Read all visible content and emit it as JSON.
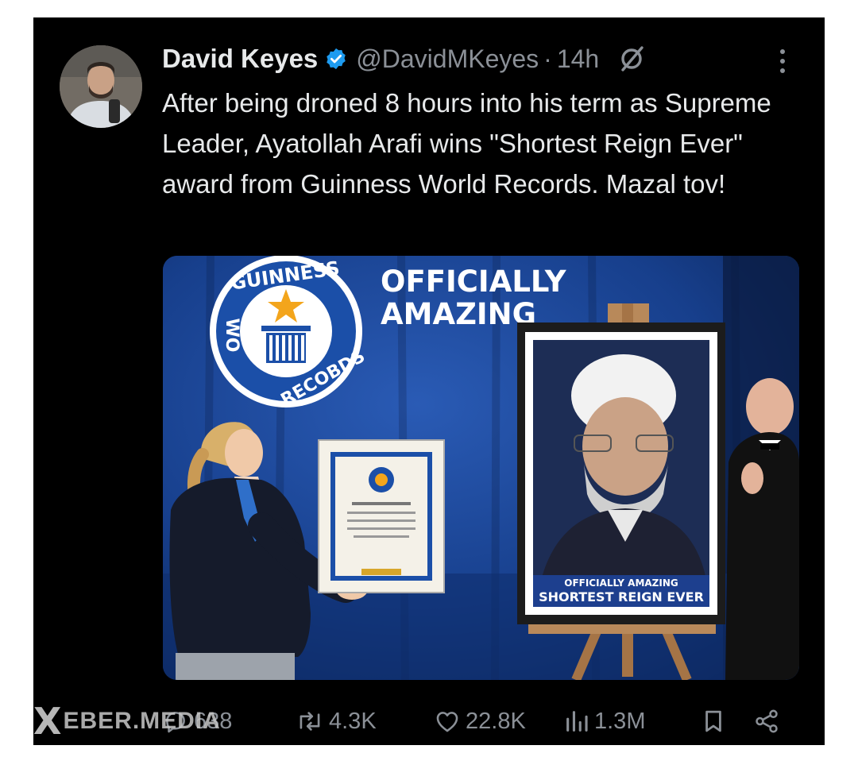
{
  "tweet": {
    "display_name": "David Keyes",
    "handle": "@DavidMKeyes",
    "separator": "·",
    "time": "14h",
    "text": "After being droned 8 hours into his term as Supreme Leader, Ayatollah Arafi wins \"Shortest Reign Ever\" award from Guinness World Records. Mazal tov!",
    "icons": [
      "verified-badge-icon",
      "grok-icon",
      "more-options-icon"
    ],
    "verified_color": "#1d9bf0"
  },
  "media": {
    "logo_top_text": "GUINNESS",
    "logo_left_text": "WO",
    "logo_bottom_text": "RECOBDS",
    "banner_line1": "OFFICIALLY",
    "banner_line2": "AMAZING",
    "portrait_caption_line1": "OFFICIALLY AMAZING",
    "portrait_caption_line2": "SHORTEST REIGN EVER"
  },
  "actions": {
    "replies": "638",
    "reposts": "4.3K",
    "likes": "22.8K",
    "views": "1.3M",
    "icons": [
      "reply-icon",
      "repost-icon",
      "like-icon",
      "views-icon",
      "bookmark-icon",
      "share-icon"
    ]
  },
  "watermark": {
    "x_mark": "X",
    "text": "EBER.MEDIA"
  },
  "colors": {
    "background": "#000000",
    "text": "#e7e9ea",
    "muted": "#8b9097",
    "stage_blue": "#163a82"
  }
}
